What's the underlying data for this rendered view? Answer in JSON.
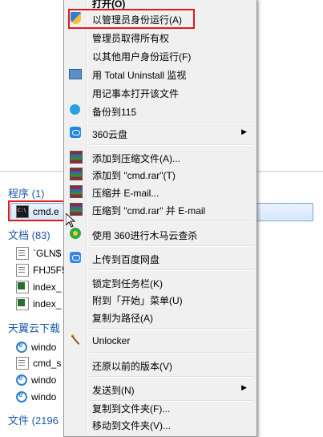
{
  "context_menu": {
    "open_label": "打开(O)",
    "items": [
      {
        "label": "以管理员身份运行(A)",
        "icon": "uac-shield-icon"
      },
      {
        "label": "管理员取得所有权",
        "icon": ""
      },
      {
        "label": "以其他用户身份运行(F)",
        "icon": ""
      },
      {
        "label": "用 Total Uninstall 监视",
        "icon": "monitor-icon"
      },
      {
        "label": "用记事本打开该文件",
        "icon": ""
      },
      {
        "label": "备份到115",
        "icon": "cloud-icon"
      },
      {
        "label": "360云盘",
        "icon": "360-cloud-icon",
        "submenu": true
      },
      {
        "label": "添加到压缩文件(A)...",
        "icon": "rar-icon"
      },
      {
        "label": "添加到 \"cmd.rar\"(T)",
        "icon": "rar-icon"
      },
      {
        "label": "压缩并 E-mail...",
        "icon": "rar-icon"
      },
      {
        "label": "压缩到 \"cmd.rar\" 并 E-mail",
        "icon": "rar-icon"
      },
      {
        "label": "使用 360进行木马云查杀",
        "icon": "360-scan-icon"
      },
      {
        "label": "上传到百度网盘",
        "icon": "baidu-cloud-icon"
      },
      {
        "label": "锁定到任务栏(K)",
        "icon": ""
      },
      {
        "label": "附到「开始」菜单(U)",
        "icon": ""
      },
      {
        "label": "复制为路径(A)",
        "icon": ""
      },
      {
        "label": "Unlocker",
        "icon": "unlocker-wand-icon"
      },
      {
        "label": "还原以前的版本(V)",
        "icon": ""
      },
      {
        "label": "发送到(N)",
        "icon": "",
        "submenu": true
      },
      {
        "label": "复制到文件夹(F)...",
        "icon": ""
      },
      {
        "label": "移动到文件夹(V)...",
        "icon": ""
      }
    ]
  },
  "results": {
    "groups": [
      {
        "title": "程序 (1)",
        "items": [
          "cmd.e"
        ]
      },
      {
        "title": "文档 (83)",
        "items": [
          "`GLN$",
          "FHJ5F5",
          "index_",
          "index_"
        ]
      },
      {
        "title": "天翼云下载",
        "items": [
          "windo",
          "cmd_s",
          "windo",
          "windo"
        ]
      },
      {
        "title": "文件 (2196",
        "items": []
      }
    ]
  },
  "colors": {
    "highlight": "#e01a1a",
    "group_title": "#1e5ba8"
  }
}
